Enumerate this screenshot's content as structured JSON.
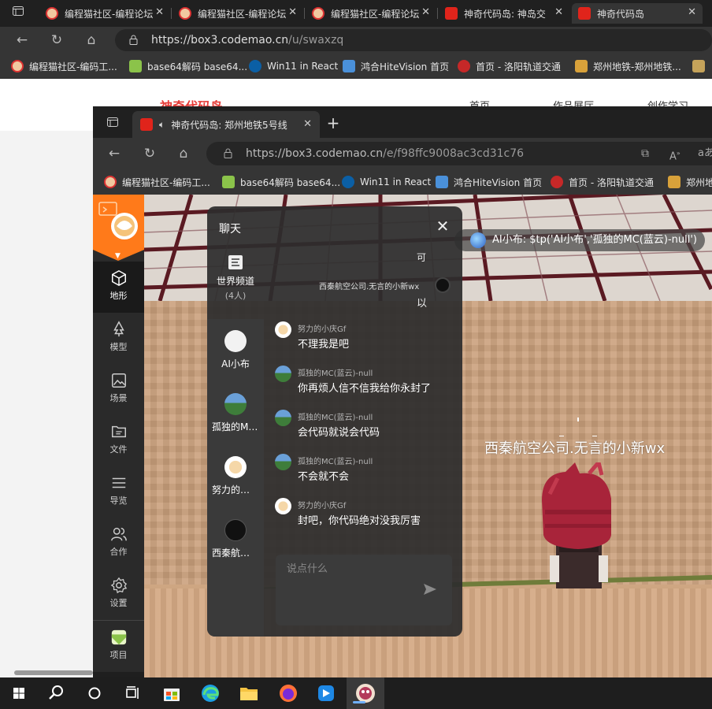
{
  "outer_browser": {
    "tabs": [
      {
        "label": "编程猫社区-编程论坛"
      },
      {
        "label": "编程猫社区-编程论坛"
      },
      {
        "label": "编程猫社区-编程论坛"
      },
      {
        "label": "神奇代码岛: 神岛交"
      },
      {
        "label": "神奇代码岛"
      }
    ],
    "url_domain": "https://box3.codemao.cn",
    "url_path": "/u/swaxzq",
    "bookmarks": [
      {
        "label": "编程猫社区-编码工..."
      },
      {
        "label": "base64解码 base64..."
      },
      {
        "label": "Win11 in React"
      },
      {
        "label": "鸿合HiteVision 首页"
      },
      {
        "label": "首页 - 洛阳轨道交通"
      },
      {
        "label": "郑州地铁-郑州地铁..."
      }
    ],
    "site_logo": "神奇代码岛",
    "site_nav": [
      "首页",
      "作品展厅",
      "创作学习"
    ]
  },
  "inner_browser": {
    "tab_label": "神奇代码岛: 郑州地铁5号线",
    "url_domain": "https://box3.codemao.cn",
    "url_path": "/e/f98ffc9008ac3cd31c76",
    "bookmarks": [
      {
        "label": "编程猫社区-编码工..."
      },
      {
        "label": "base64解码 base64..."
      },
      {
        "label": "Win11 in React"
      },
      {
        "label": "鸿合HiteVision 首页"
      },
      {
        "label": "首页 - 洛阳轨道交通"
      },
      {
        "label": "郑州地"
      }
    ]
  },
  "sidebar": {
    "items": [
      {
        "label": "地形",
        "icon": "cube-icon"
      },
      {
        "label": "模型",
        "icon": "tree-icon"
      },
      {
        "label": "场景",
        "icon": "image-icon"
      },
      {
        "label": "文件",
        "icon": "folder-icon"
      },
      {
        "label": "导览",
        "icon": "list-icon"
      },
      {
        "label": "合作",
        "icon": "users-icon"
      },
      {
        "label": "设置",
        "icon": "gear-icon"
      },
      {
        "label": "项目",
        "icon": "project-icon"
      }
    ]
  },
  "scene": {
    "ai_banner": "AI小布: $tp('AI小布','孤独的MC(蓝云)-null')",
    "player_name": "西秦航空公司.无言的小新wx"
  },
  "chat": {
    "title": "聊天",
    "world_channel": "世界频道",
    "world_count": "(4人)",
    "ghost_line": "西秦航空公司.无言的小新wx",
    "ghost_char1": "可",
    "ghost_char2": "以",
    "channels": [
      {
        "name": "AI小布"
      },
      {
        "name": "孤独的MC(蓝云)-null"
      },
      {
        "name": "努力的小庆Gf"
      },
      {
        "name": "西秦航空公司.无言的小新wx"
      }
    ],
    "messages": [
      {
        "sender": "努力的小庆Gf",
        "text": "不理我是吧"
      },
      {
        "sender": "孤独的MC(蓝云)-null",
        "text": "你再烦人信不信我给你永封了"
      },
      {
        "sender": "孤独的MC(蓝云)-null",
        "text": "会代码就说会代码"
      },
      {
        "sender": "孤独的MC(蓝云)-null",
        "text": "不会就不会"
      },
      {
        "sender": "努力的小庆Gf",
        "text": "封吧，你代码绝对没我厉害"
      }
    ],
    "input_placeholder": "说点什么"
  },
  "colors": {
    "accent_orange": "#ff7a1a",
    "browser_dark": "#202020",
    "toolbar": "#353535"
  }
}
